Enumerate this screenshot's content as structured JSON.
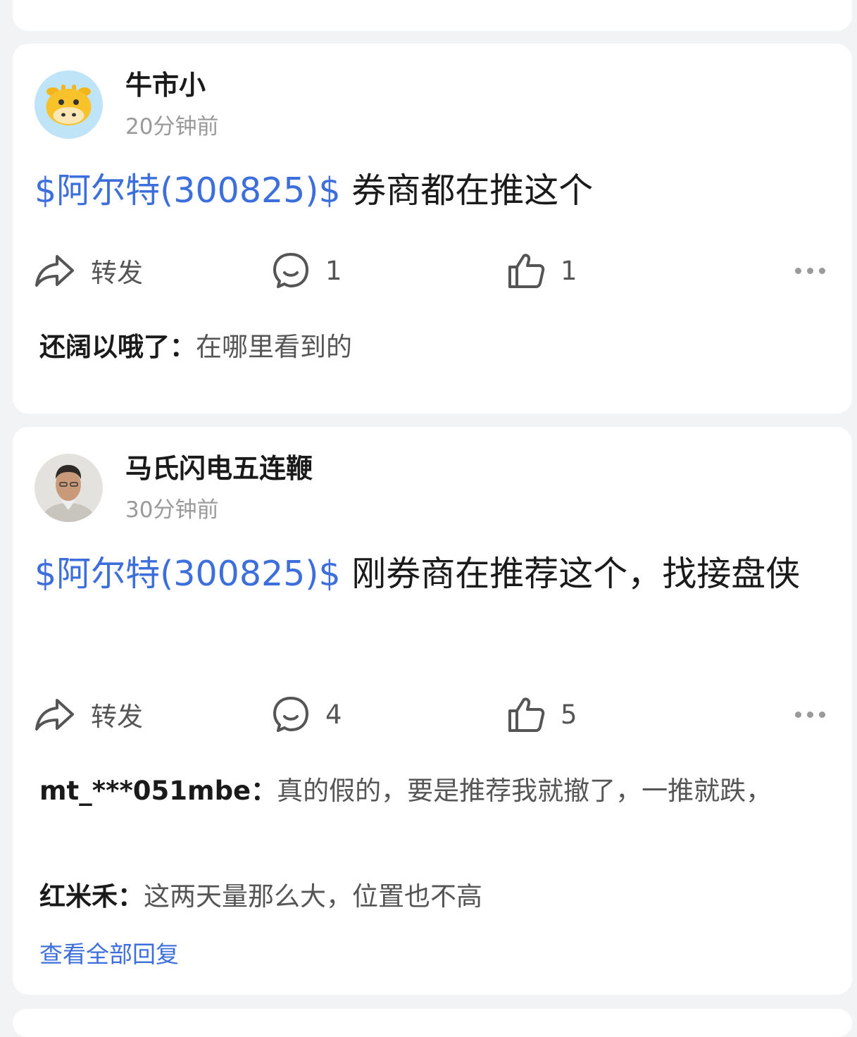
{
  "posts": [
    {
      "username": "牛市小",
      "time": "20分钟前",
      "stock_tag": "$阿尔特(300825)$",
      "text": " 券商都在推这个",
      "share_label": "转发",
      "comment_count": "1",
      "like_count": "1",
      "replies": [
        {
          "author": "还阔以哦了：",
          "text": "在哪里看到的"
        }
      ]
    },
    {
      "username": "马氏闪电五连鞭",
      "time": "30分钟前",
      "stock_tag": "$阿尔特(300825)$",
      "text": " 刚券商在推荐这个，找接盘侠",
      "share_label": "转发",
      "comment_count": "4",
      "like_count": "5",
      "replies": [
        {
          "author": "mt_***051mbe：",
          "text": "真的假的，要是推荐我就撤了，一推就跌，"
        },
        {
          "author": "红米禾：",
          "text": "这两天量那么大，位置也不高"
        }
      ],
      "view_all_label": "查看全部回复"
    }
  ],
  "colors": {
    "link": "#3d6fdc",
    "background": "#f2f3f5",
    "card": "#ffffff"
  }
}
